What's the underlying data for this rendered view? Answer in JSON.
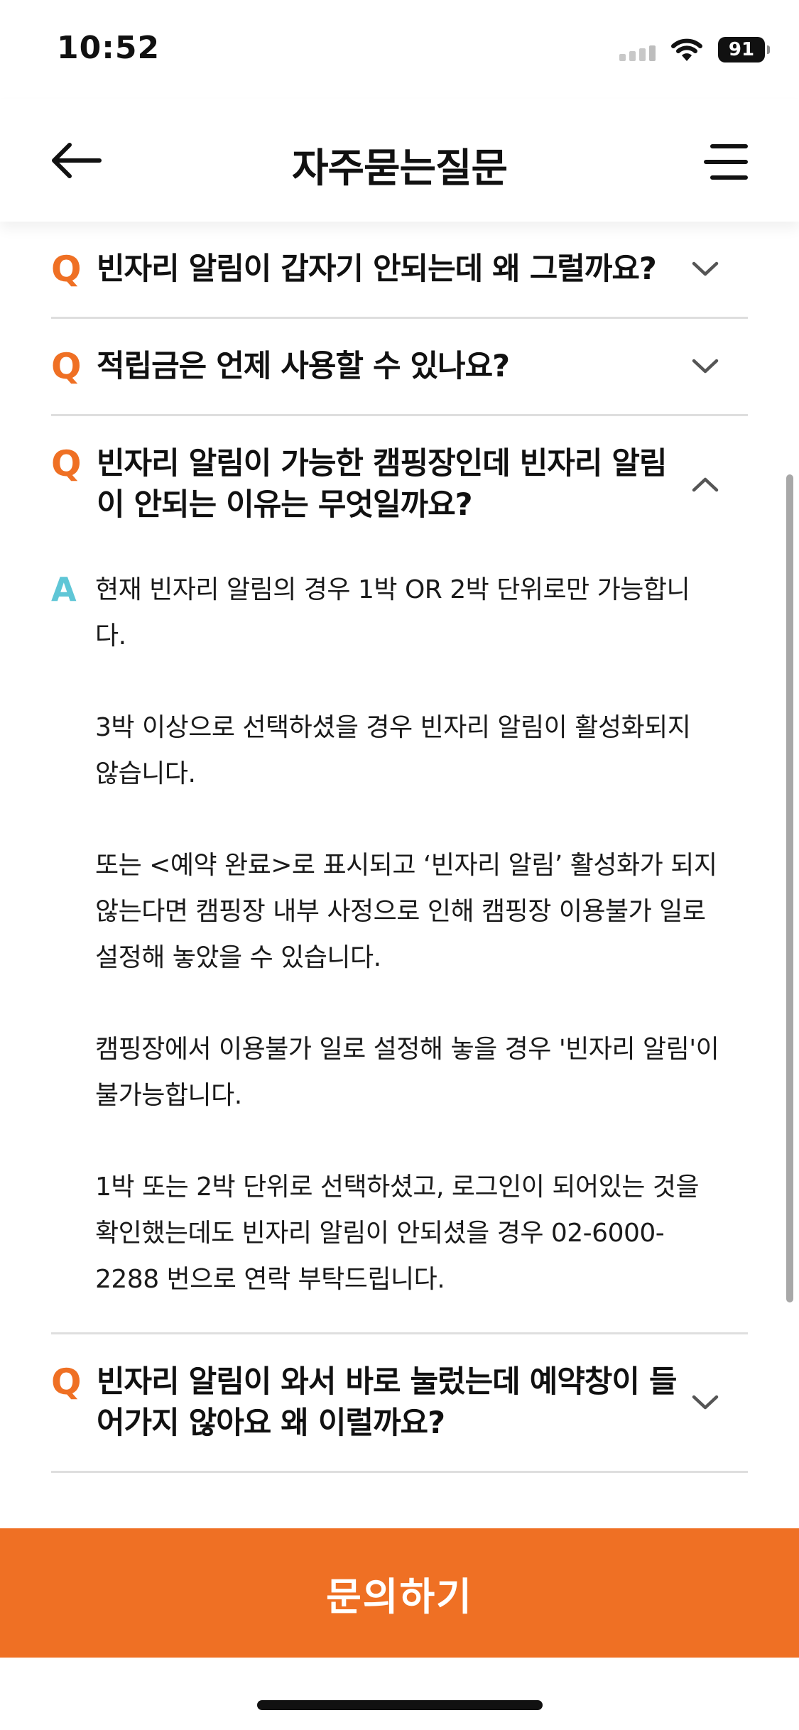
{
  "status_bar": {
    "time": "10:52",
    "battery": "91"
  },
  "header": {
    "title": "자주묻는질문"
  },
  "faq": {
    "q_mark": "Q",
    "a_mark": "A",
    "items": [
      {
        "question": "빈자리 알림이 갑자기 안되는데 왜 그럴까요?",
        "expanded": false
      },
      {
        "question": "적립금은 언제 사용할 수 있나요?",
        "expanded": false
      },
      {
        "question": "빈자리 알림이 가능한 캠핑장인데 빈자리 알림이 안되는 이유는 무엇일까요?",
        "expanded": true,
        "answer": [
          "현재 빈자리 알림의 경우 1박 OR 2박 단위로만 가능합니다.",
          "3박 이상으로 선택하셨을 경우 빈자리 알림이 활성화되지 않습니다.",
          "또는 <예약 완료>로 표시되고 ‘빈자리 알림’ 활성화가 되지 않는다면 캠핑장 내부 사정으로 인해 캠핑장 이용불가 일로 설정해 놓았을 수 있습니다.",
          "캠핑장에서 이용불가 일로 설정해 놓을 경우 '빈자리 알림'이 불가능합니다.",
          "1박 또는 2박 단위로 선택하셨고, 로그인이 되어있는 것을 확인했는데도 빈자리 알림이 안되셨을 경우 02-6000-2288 번으로 연락 부탁드립니다."
        ]
      },
      {
        "question": "빈자리 알림이 와서 바로 눌렀는데 예약창이 들어가지 않아요 왜 이럴까요?",
        "expanded": false
      }
    ]
  },
  "cta": {
    "label": "문의하기"
  },
  "colors": {
    "accent": "#ef7024",
    "answer_mark": "#5fc6d6",
    "divider": "#dedede"
  },
  "icons": {
    "back": "arrow-left-icon",
    "menu": "menu-icon",
    "collapsed": "chevron-down-icon",
    "expanded": "chevron-up-icon"
  }
}
